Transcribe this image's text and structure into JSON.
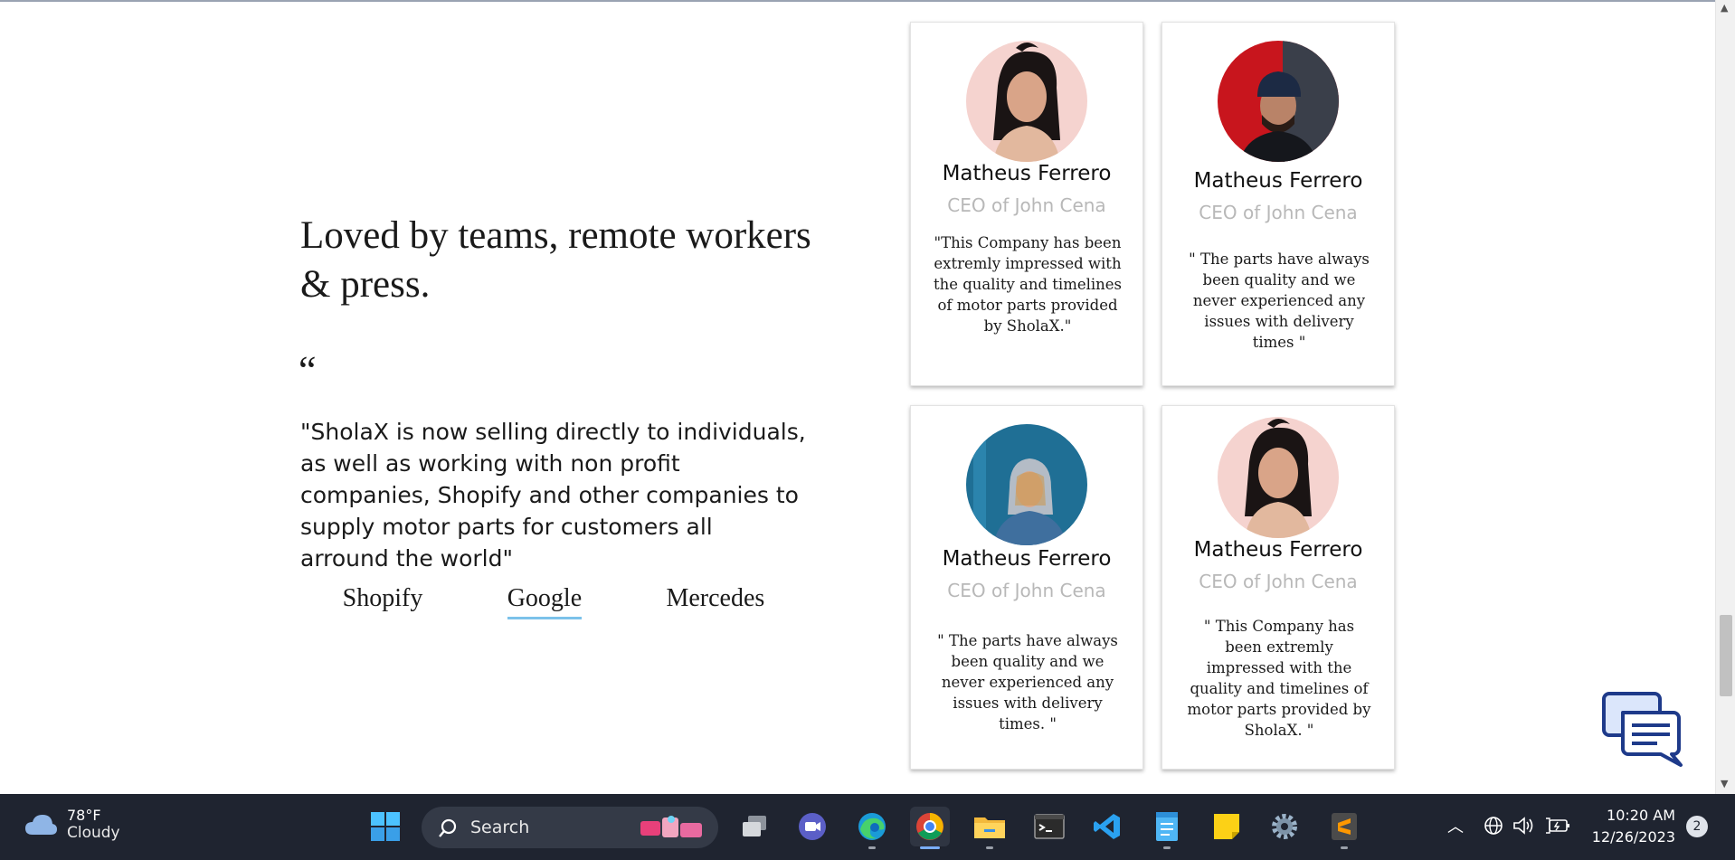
{
  "section": {
    "headline": "Loved by teams, remote workers & press.",
    "quote_mark": "“",
    "quote": "\"SholaX is now selling directly to individuals, as well as working with non profit companies, Shopify and other companies to supply motor parts for customers all arround the world\"",
    "brands": [
      {
        "label": "Shopify",
        "active": false
      },
      {
        "label": "Google",
        "active": true
      },
      {
        "label": "Mercedes",
        "active": false
      }
    ]
  },
  "cards": [
    {
      "name": "Matheus Ferrero",
      "role": "CEO of John Cena",
      "testimonial": "\"This Company has been extremly impressed with the quality and timelines of motor parts provided by SholaX.\"",
      "avatar": "woman-portrait-avatar"
    },
    {
      "name": "Matheus Ferrero",
      "role": "CEO of John Cena",
      "testimonial": "\" The parts have always been quality and we never experienced any issues with delivery times \"",
      "avatar": "man-cap-portrait-avatar"
    },
    {
      "name": "Matheus Ferrero",
      "role": "CEO of John Cena",
      "testimonial": "\" The parts have always been quality and we never experienced any issues with delivery times. \"",
      "avatar": "hooded-person-portrait-avatar"
    },
    {
      "name": "Matheus Ferrero",
      "role": "CEO of John Cena",
      "testimonial": "\" This Company has been extremly impressed with the quality and timelines of motor parts provided by SholaX. \"",
      "avatar": "woman-portrait-avatar"
    }
  ],
  "taskbar": {
    "weather_temp": "78°F",
    "weather_condition": "Cloudy",
    "search_label": "Search",
    "time": "10:20 AM",
    "date": "12/26/2023",
    "notification_count": "2",
    "apps": [
      "start",
      "task-view",
      "meet",
      "edge",
      "chrome",
      "file-explorer",
      "terminal",
      "vscode",
      "notepad",
      "sticky-notes",
      "settings",
      "sublime-text"
    ]
  },
  "colors": {
    "accent_underline": "#7cc2ea",
    "role_gray": "#b8b8b8",
    "taskbar_bg": "#1f2430",
    "chat_icon": "#1e3a8a"
  }
}
